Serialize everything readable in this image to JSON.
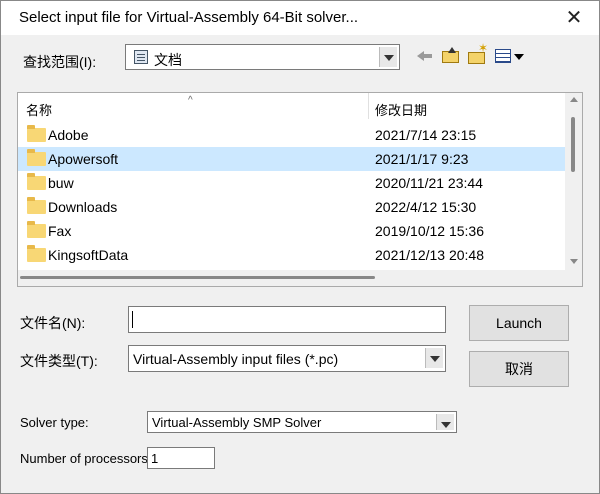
{
  "dialog": {
    "title": "Select input file for Virtual-Assembly 64-Bit solver...",
    "close_glyph": "✕"
  },
  "lookin": {
    "label": "查找范围(I):",
    "value": "文档"
  },
  "toolbar": {
    "icons": [
      "back-icon",
      "up-one-level-icon",
      "new-folder-icon",
      "view-menu-icon"
    ]
  },
  "filelist": {
    "columns": [
      "名称",
      "修改日期"
    ],
    "rows": [
      {
        "name": "Adobe",
        "date": "2021/7/14 23:15"
      },
      {
        "name": "Apowersoft",
        "date": "2021/1/17 9:23"
      },
      {
        "name": "buw",
        "date": "2020/11/21 23:44"
      },
      {
        "name": "Downloads",
        "date": "2022/4/12 15:30"
      },
      {
        "name": "Fax",
        "date": "2019/10/12 15:36"
      },
      {
        "name": "KingsoftData",
        "date": "2021/12/13 20:48"
      }
    ],
    "selected_index": 1
  },
  "filename": {
    "label": "文件名(N):",
    "value": ""
  },
  "filetype": {
    "label": "文件类型(T):",
    "value": "Virtual-Assembly input files (*.pc)"
  },
  "buttons": {
    "launch": "Launch",
    "cancel": "取消"
  },
  "solver": {
    "label": "Solver type:",
    "value": "Virtual-Assembly SMP Solver"
  },
  "processors": {
    "label": "Number of processors=",
    "value": "1"
  },
  "colors": {
    "selection": "#cce8ff",
    "dialog_bg": "#f0f0f0",
    "folder": "#f8d775"
  }
}
